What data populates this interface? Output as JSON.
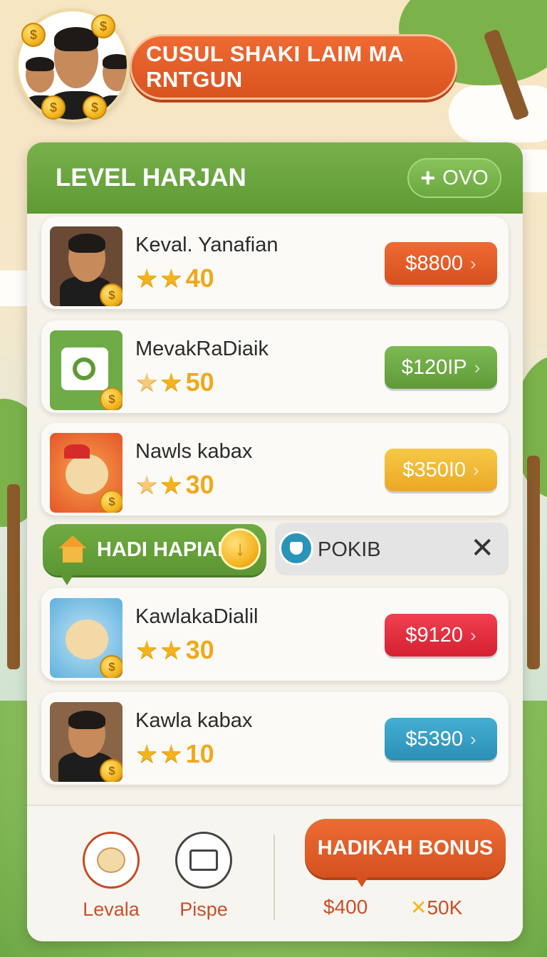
{
  "header": {
    "title": "CUSUL SHAKI LAIM MA RNTGUN",
    "coin_symbol": "$"
  },
  "panel": {
    "title": "LEVEL HARJAN",
    "add_label": "OVO",
    "items": [
      {
        "name": "Keval. Yanafian",
        "stars": "40",
        "price": "$8800",
        "color": "#e4582a",
        "thumb": "person"
      },
      {
        "name": "MevakRaDiaik",
        "stars": "50",
        "price": "$120IP",
        "color": "#6fab47",
        "thumb": "app"
      },
      {
        "name": "Nawls kabax",
        "stars": "30",
        "price": "$350I0",
        "color": "#f2b83a",
        "thumb": "bear-red"
      },
      {
        "name": "KawlakaDialil",
        "stars": "30",
        "price": "$9120",
        "color": "#e5303b",
        "thumb": "bear-blue"
      },
      {
        "name": "Kawla kabax",
        "stars": "10",
        "price": "$5390",
        "color": "#2f9bc1",
        "thumb": "person"
      }
    ]
  },
  "banner": {
    "left_label": "HADI HAPIAN",
    "right_label": "POKIB"
  },
  "footer": {
    "item1_label": "Levala",
    "item2_label": "Pispe",
    "bonus_label": "HADIKAH BONUS",
    "bonus_value_1": "$400",
    "bonus_value_2": "50K"
  }
}
